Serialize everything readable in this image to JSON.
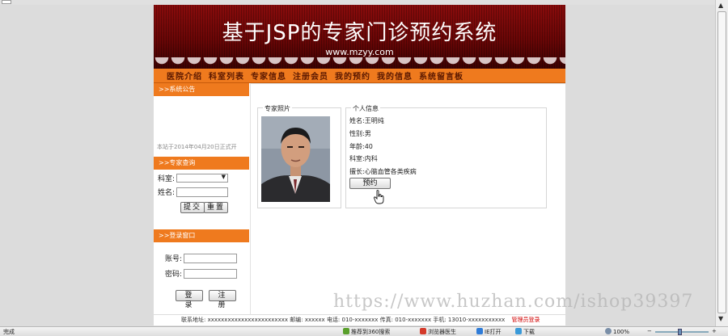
{
  "site": {
    "title": "基于JSP的专家门诊预约系统",
    "url": "www.mzyy.com"
  },
  "nav": {
    "items": [
      "医院介绍",
      "科室列表",
      "专家信息",
      "注册会员",
      "我的预约",
      "我的信息",
      "系统留言板"
    ]
  },
  "sidebar": {
    "notice": {
      "title": ">>系统公告",
      "text": "本站于2014年04月20日正式开"
    },
    "search": {
      "title": ">>专家查询",
      "dept_label": "科室:",
      "dept_value": "",
      "name_label": "姓名:",
      "name_value": "",
      "submit_label": "提交",
      "reset_label": "重置"
    },
    "login": {
      "title": ">>登录窗口",
      "account_label": "账号:",
      "account_value": "",
      "password_label": "密码:",
      "password_value": "",
      "login_label": "登 录",
      "register_label": "注 册"
    }
  },
  "expert": {
    "photo_title": "专家照片",
    "info_title": "个人信息",
    "fields": [
      {
        "label": "姓名:",
        "value": "王明纯"
      },
      {
        "label": "性别:",
        "value": "男"
      },
      {
        "label": "年龄:",
        "value": "40"
      },
      {
        "label": "科室:",
        "value": "内科"
      },
      {
        "label": "擅长:",
        "value": "心脑血管各类疾病"
      }
    ],
    "book_label": "预约"
  },
  "footer": {
    "address": "联系地址: xxxxxxxxxxxxxxxxxxxxxxxx",
    "postcode": "邮编: xxxxxx",
    "phone": "电话: 010-xxxxxxx",
    "fax": "传真: 010-xxxxxxx",
    "mobile": "手机: 13010-xxxxxxxxxxx",
    "admin_link": "管理员登录"
  },
  "watermark": "https://www.huzhan.com/ishop39397",
  "statusbar": {
    "status": "完成",
    "item1": "推荐到360搜索",
    "item2": "浏览器医生",
    "item3": "IE打开",
    "item4": "下载",
    "zoom": "100%"
  },
  "colors": {
    "accent": "#ef7a1e",
    "banner": "#8a0c0c",
    "admin_link": "#d00000"
  }
}
